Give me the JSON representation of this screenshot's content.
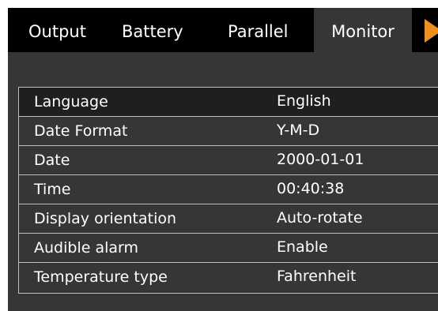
{
  "tabs": [
    {
      "label": "Output"
    },
    {
      "label": "Battery"
    },
    {
      "label": "Parallel"
    },
    {
      "label": "Monitor",
      "active": true
    }
  ],
  "next_icon": "play-arrow-icon",
  "accent_color": "#f0901e",
  "settings": [
    {
      "label": "Language",
      "value": "English"
    },
    {
      "label": "Date Format",
      "value": "Y-M-D"
    },
    {
      "label": "Date",
      "value": "2000-01-01"
    },
    {
      "label": "Time",
      "value": "00:40:38"
    },
    {
      "label": "Display orientation",
      "value": "Auto-rotate"
    },
    {
      "label": "Audible alarm",
      "value": "Enable"
    },
    {
      "label": "Temperature type",
      "value": "Fahrenheit"
    }
  ]
}
